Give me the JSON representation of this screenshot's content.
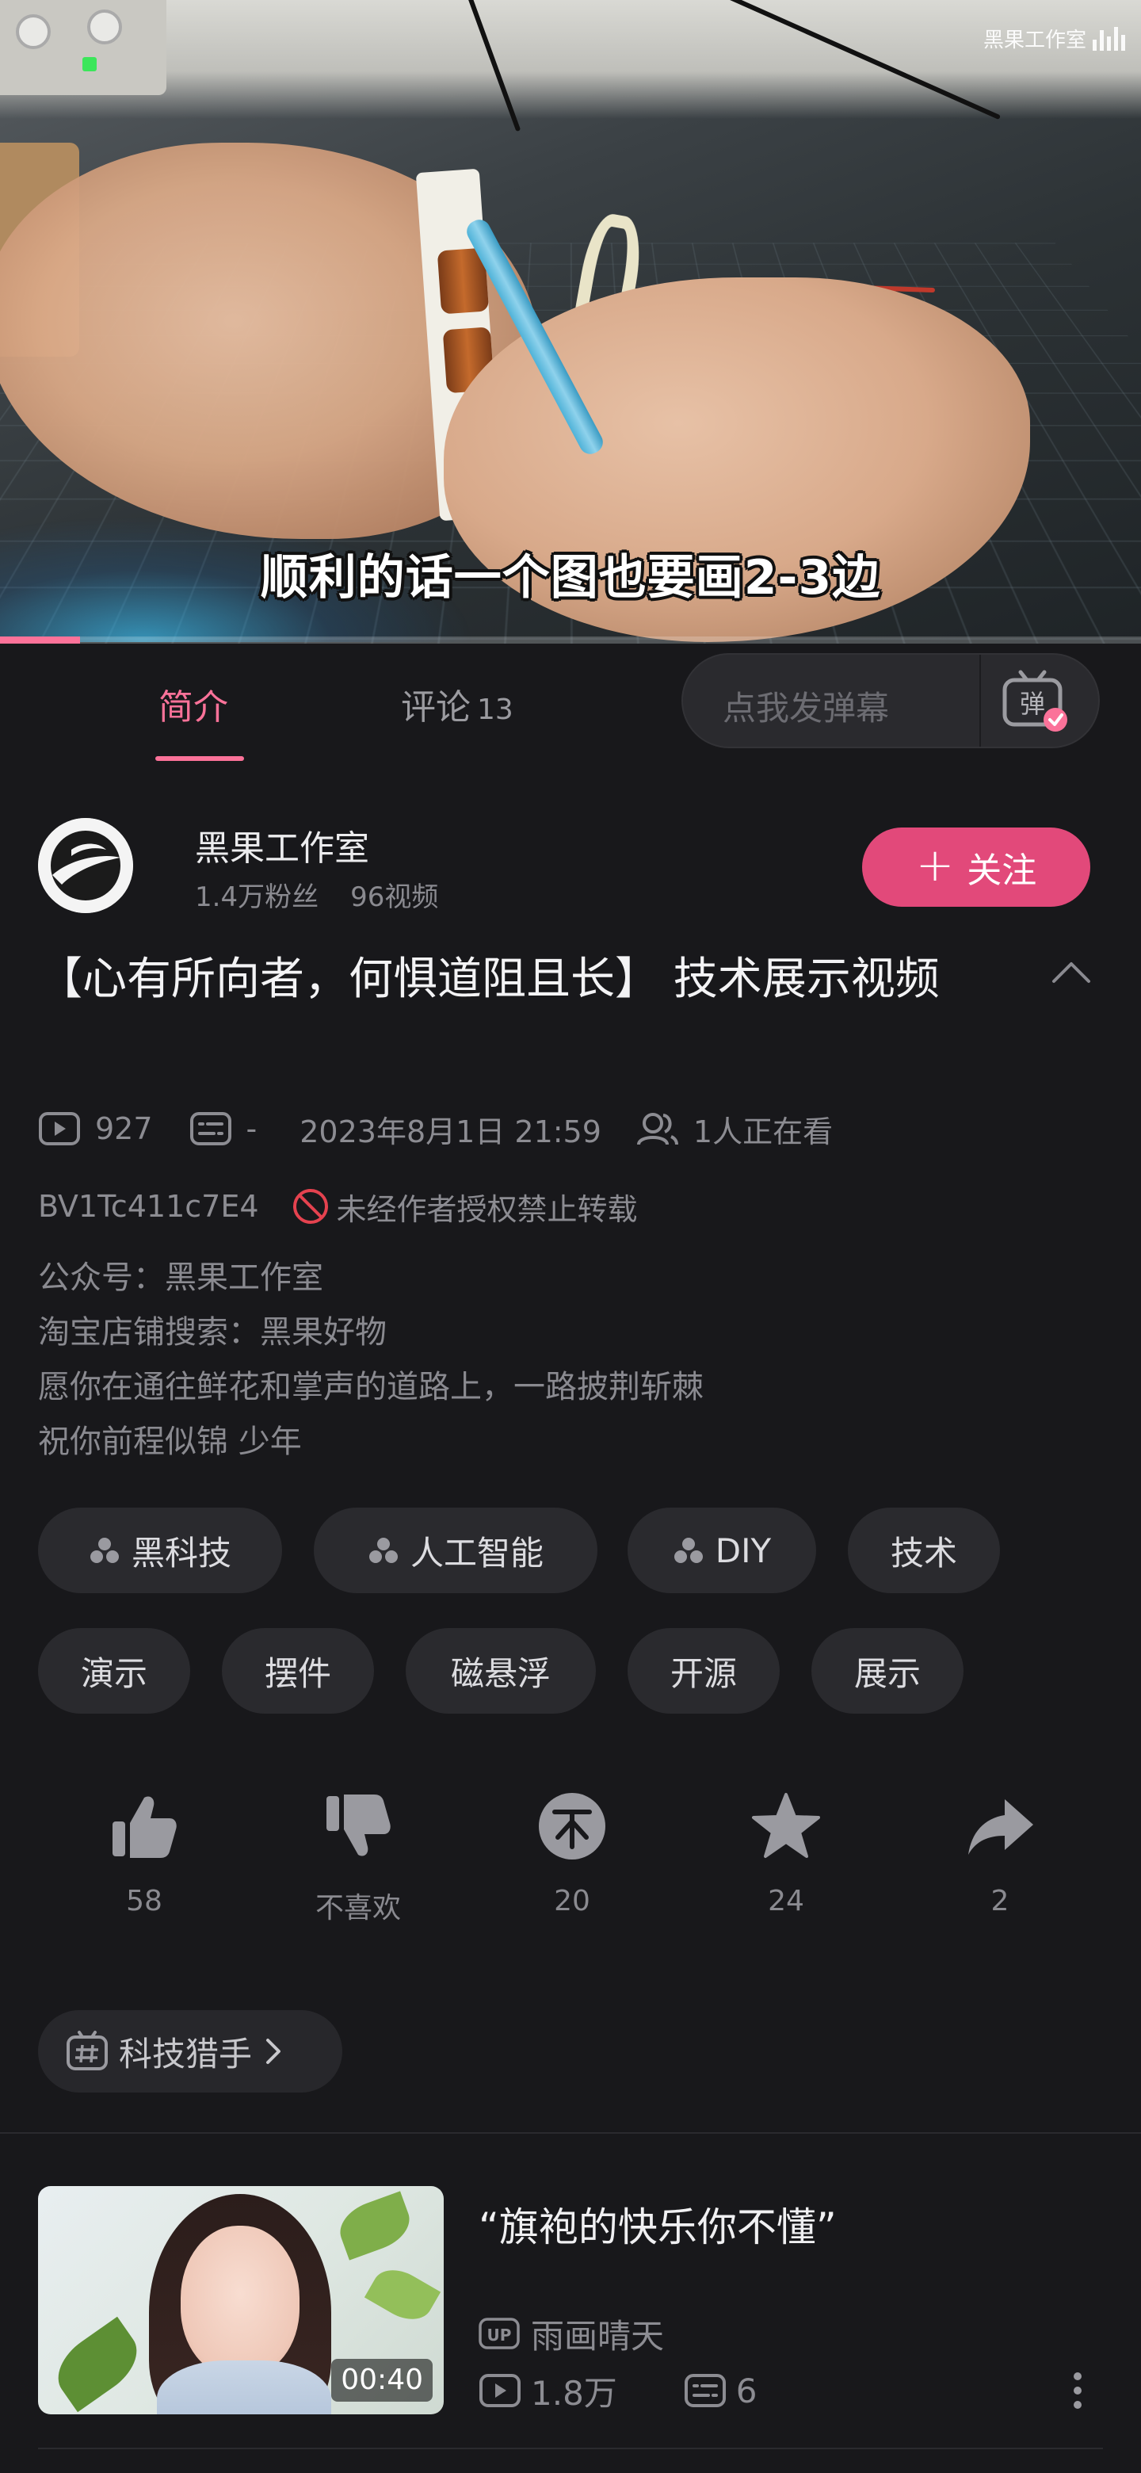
{
  "video": {
    "subtitle": "顺利的话一个图也要画2-3边",
    "watermark": "黑果工作室",
    "progress": 0.07
  },
  "tabs": {
    "intro": "简介",
    "comments": "评论",
    "comments_count": "13",
    "danmaku_placeholder": "点我发弹幕",
    "danmaku_icon_label": "弹"
  },
  "author": {
    "name": "黑果工作室",
    "fans": "1.4万粉丝",
    "videos": "96视频",
    "follow_label": "关注",
    "follow_plus": "+"
  },
  "video_info": {
    "title": "【心有所向者，何惧道阻且长】 技术展示视频",
    "plays": "927",
    "danmaku": "-",
    "date": "2023年8月1日 21:59",
    "watching": "1人正在看",
    "bvid": "BV1Tc411c7E4",
    "no_repost": "未经作者授权禁止转载",
    "description": [
      "公众号：黑果工作室",
      "淘宝店铺搜索：黑果好物",
      "愿你在通往鲜花和掌声的道路上，一路披荆斩棘",
      "祝你前程似锦 少年"
    ]
  },
  "tags": [
    {
      "label": "黑科技",
      "channel": true
    },
    {
      "label": "人工智能",
      "channel": true
    },
    {
      "label": "DIY",
      "channel": true
    },
    {
      "label": "技术",
      "channel": false
    },
    {
      "label": "演示",
      "channel": false
    },
    {
      "label": "摆件",
      "channel": false
    },
    {
      "label": "磁悬浮",
      "channel": false
    },
    {
      "label": "开源",
      "channel": false
    },
    {
      "label": "展示",
      "channel": false
    }
  ],
  "actions": {
    "like": "58",
    "dislike": "不喜欢",
    "coin": "20",
    "favorite": "24",
    "share": "2"
  },
  "topic": {
    "label": "科技猎手"
  },
  "recommendation": {
    "title": "“旗袍的快乐你不懂”",
    "duration": "00:40",
    "up_name": "雨画晴天",
    "plays": "1.8万",
    "danmaku": "6"
  },
  "colors": {
    "accent": "#fb7299",
    "follow_bg": "#e2497a",
    "background": "#18181b",
    "chip": "#2a2a2e"
  }
}
